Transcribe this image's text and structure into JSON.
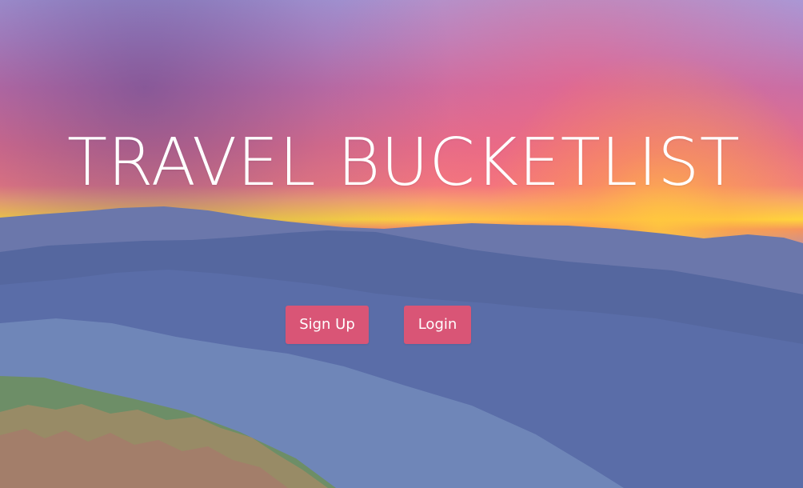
{
  "hero": {
    "title": "TRAVEL BUCKETLIST"
  },
  "actions": {
    "signup_label": "Sign Up",
    "login_label": "Login"
  },
  "colors": {
    "button_background": "#d95576",
    "button_text": "#ffffff",
    "title_text": "#ffffff"
  }
}
